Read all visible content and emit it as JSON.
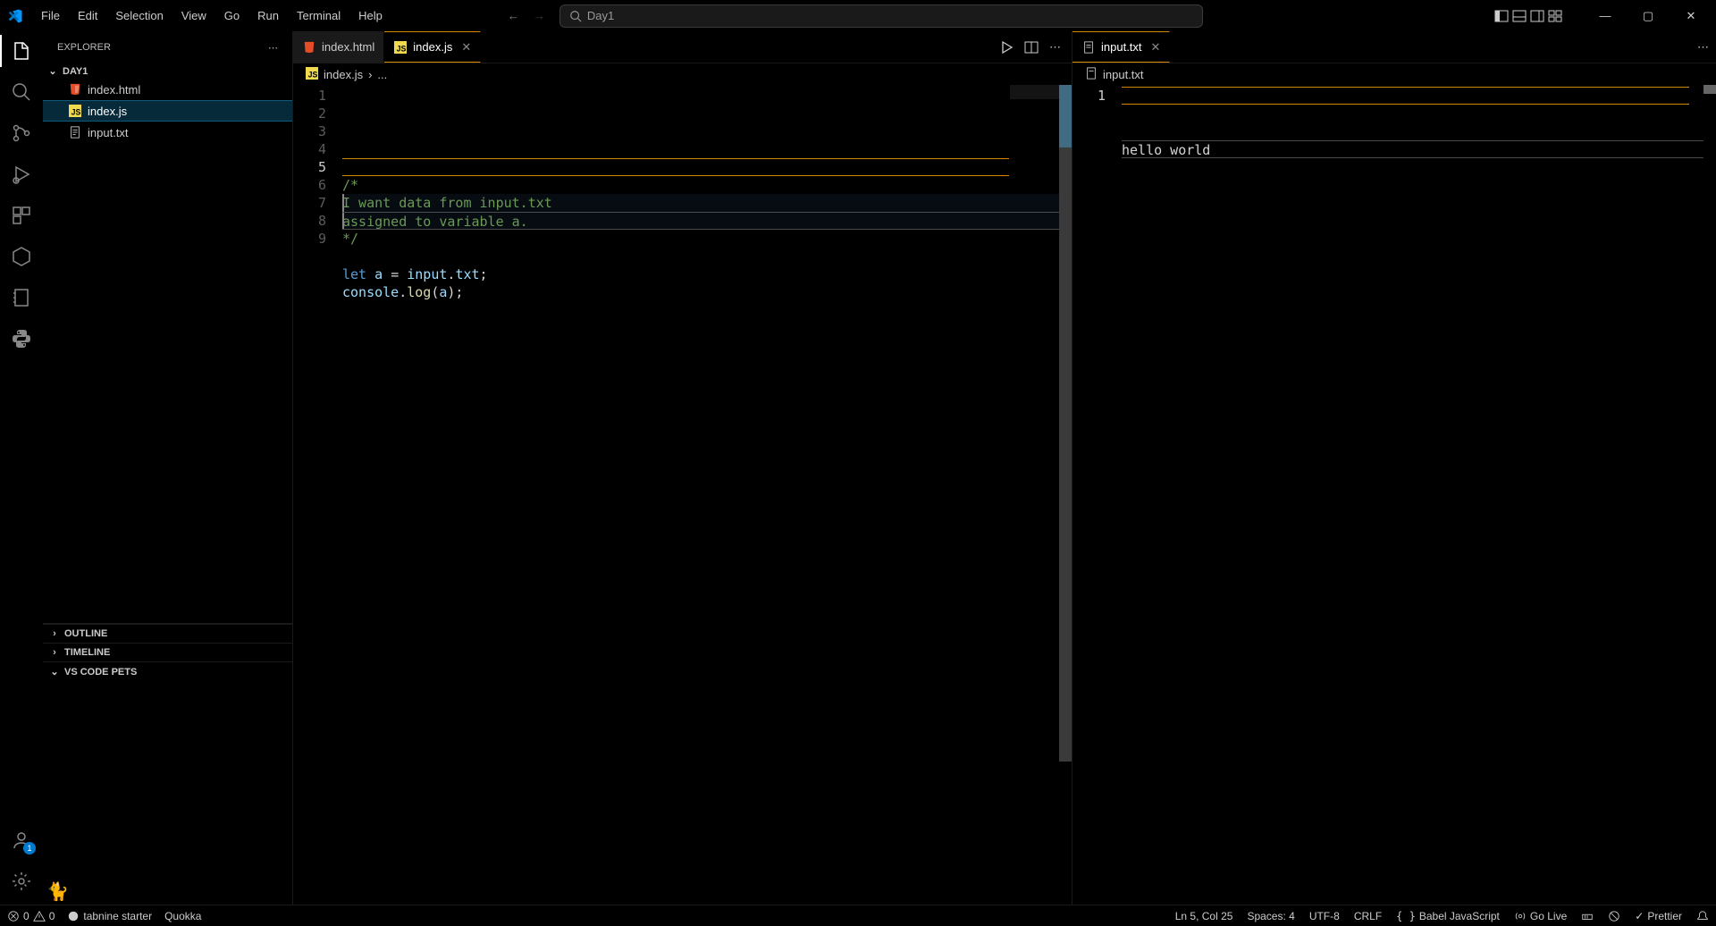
{
  "titlebar": {
    "menus": [
      "File",
      "Edit",
      "Selection",
      "View",
      "Go",
      "Run",
      "Terminal",
      "Help"
    ],
    "search_placeholder": "Day1"
  },
  "activity": {
    "explorer_active": true
  },
  "sidebar": {
    "title": "EXPLORER",
    "folder": "DAY1",
    "files": [
      {
        "name": "index.html",
        "icon": "html"
      },
      {
        "name": "index.js",
        "icon": "js",
        "active": true
      },
      {
        "name": "input.txt",
        "icon": "txt"
      }
    ],
    "sections": {
      "outline": "OUTLINE",
      "timeline": "TIMELINE",
      "pets": "VS CODE PETS"
    }
  },
  "editor_left": {
    "tabs": [
      {
        "label": "index.html",
        "icon": "html",
        "active": false,
        "close": false
      },
      {
        "label": "index.js",
        "icon": "js",
        "active": true,
        "close": true
      }
    ],
    "breadcrumb": {
      "icon": "js",
      "file": "index.js",
      "sep": "›",
      "rest": "..."
    },
    "lines": [
      {
        "num": "1",
        "html": ""
      },
      {
        "num": "2",
        "html": ""
      },
      {
        "num": "3",
        "html": "<span class='c-comment'>/*</span>"
      },
      {
        "num": "4",
        "html": "<span class='c-comment'>I want data from input.txt</span>",
        "bar": true,
        "highlight": true
      },
      {
        "num": "5",
        "html": "<span class='c-comment'>assigned to variable a.</span>",
        "bar": true,
        "highlight": true,
        "current": true,
        "cursor": true
      },
      {
        "num": "6",
        "html": "<span class='c-comment'>*/</span>"
      },
      {
        "num": "7",
        "html": ""
      },
      {
        "num": "8",
        "html": "<span class='c-keyword'>let</span> <span class='c-var'>a</span> <span class='c-punc'>=</span> <span class='c-var'>input</span><span class='c-punc'>.</span><span class='c-prop'>txt</span><span class='c-punc'>;</span>"
      },
      {
        "num": "9",
        "html": "<span class='c-var'>console</span><span class='c-punc'>.</span><span class='c-func'>log</span><span class='c-punc'>(</span><span class='c-var'>a</span><span class='c-punc'>);</span>"
      }
    ]
  },
  "editor_right": {
    "tabs": [
      {
        "label": "input.txt",
        "icon": "txt",
        "active": true,
        "close": true
      }
    ],
    "breadcrumb": {
      "icon": "txt",
      "file": "input.txt"
    },
    "lines": [
      {
        "num": "1",
        "html": "<span class='c-text'>hello world</span>",
        "current": true
      }
    ]
  },
  "statusbar": {
    "errors": "0",
    "warnings": "0",
    "tabnine": "tabnine starter",
    "quokka": "Quokka",
    "position": "Ln 5, Col 25",
    "spaces": "Spaces: 4",
    "encoding": "UTF-8",
    "eol": "CRLF",
    "language": "Babel JavaScript",
    "golive": "Go Live",
    "prettier": "Prettier"
  }
}
